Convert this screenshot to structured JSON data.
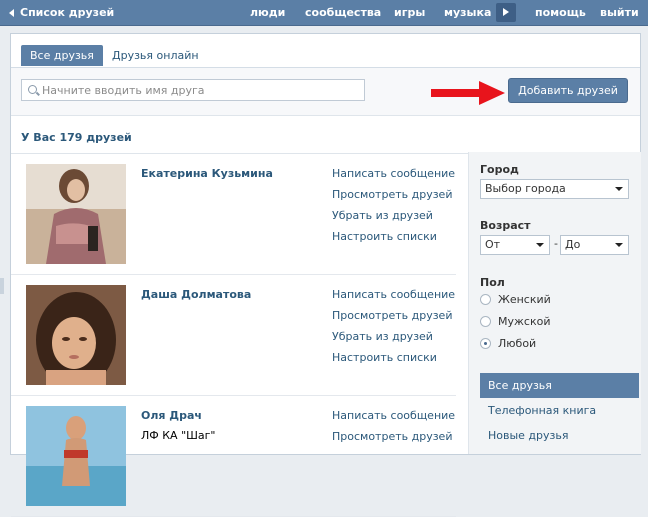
{
  "topbar": {
    "back_label": "Список друзей",
    "nav": [
      "люди",
      "сообщества",
      "игры",
      "музыка"
    ],
    "help": "помощь",
    "logout": "выйти"
  },
  "tabs": {
    "all": "Все друзья",
    "online": "Друзья онлайн"
  },
  "search": {
    "placeholder": "Начните вводить имя друга"
  },
  "add_button": "Добавить друзей",
  "friends_count": "У Вас 179 друзей",
  "friend_actions": [
    "Написать сообщение",
    "Просмотреть друзей",
    "Убрать из друзей",
    "Настроить списки"
  ],
  "friends": [
    {
      "name": "Екатерина Кузьмина",
      "sub": ""
    },
    {
      "name": "Даша Долматова",
      "sub": ""
    },
    {
      "name": "Оля Драч",
      "sub": "ЛФ КА \"Шаг\""
    }
  ],
  "filters": {
    "city_label": "Город",
    "city_value": "Выбор города",
    "age_label": "Возраст",
    "age_from": "От",
    "age_dash": "-",
    "age_to": "До",
    "sex_label": "Пол",
    "sex_options": [
      "Женский",
      "Мужской",
      "Любой"
    ],
    "sex_selected": "Любой"
  },
  "side_menu": [
    "Все друзья",
    "Телефонная книга",
    "Новые друзья"
  ],
  "colors": {
    "accent": "#5b7fa6",
    "link": "#2b587a",
    "arrow": "#e8141c"
  }
}
